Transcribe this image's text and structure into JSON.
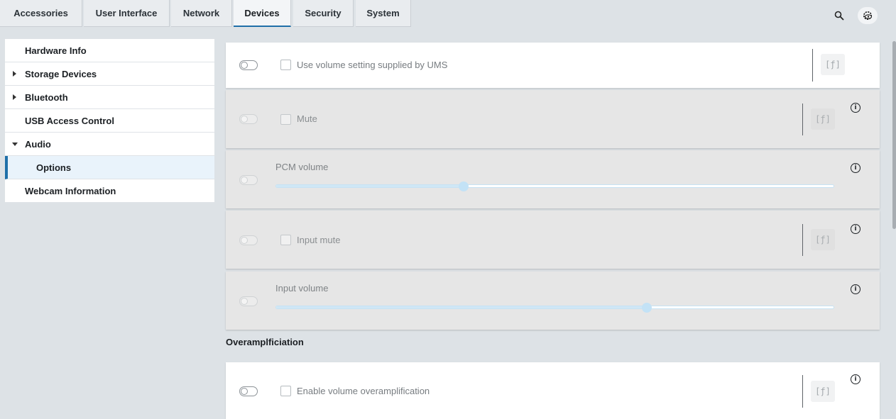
{
  "tabs": [
    {
      "label": "Accessories"
    },
    {
      "label": "User Interface"
    },
    {
      "label": "Network"
    },
    {
      "label": "Devices"
    },
    {
      "label": "Security"
    },
    {
      "label": "System"
    }
  ],
  "active_tab": "Devices",
  "header_icons": {
    "search": "search-icon",
    "settings": "settings-eye-icon"
  },
  "sidebar": {
    "items": [
      {
        "label": "Hardware Info"
      },
      {
        "label": "Storage Devices"
      },
      {
        "label": "Bluetooth"
      },
      {
        "label": "USB Access Control"
      },
      {
        "label": "Audio"
      },
      {
        "label": "Options"
      },
      {
        "label": "Webcam Information"
      }
    ]
  },
  "settings": {
    "ums_volume": {
      "label": "Use volume setting supplied by UMS",
      "fx": "[ƒ]"
    },
    "mute": {
      "label": "Mute",
      "fx": "[ƒ]",
      "info": "i"
    },
    "pcm_volume": {
      "label": "PCM volume",
      "level": 0.337,
      "info": "i"
    },
    "input_mute": {
      "label": "Input mute",
      "fx": "[ƒ]",
      "info": "i"
    },
    "input_volume": {
      "label": "Input volume",
      "level": 0.664,
      "info": "i"
    }
  },
  "overamp": {
    "title": "Overamplficiation",
    "enable": {
      "label": "Enable volume overamplification",
      "fx": "[ƒ]",
      "info": "i"
    }
  },
  "colors": {
    "accent": "#1f6fa8",
    "slider_track": "#c7e2f3",
    "slider_thumb": "#c3e2f6"
  }
}
